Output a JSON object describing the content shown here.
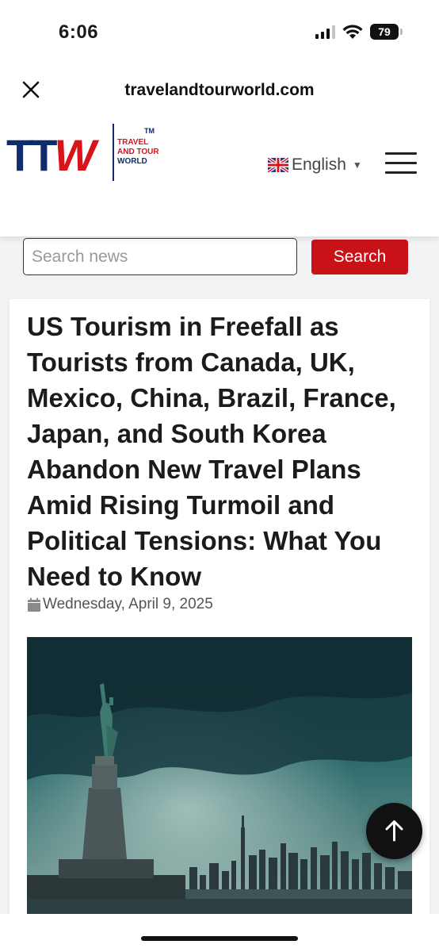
{
  "status_bar": {
    "time": "6:06",
    "battery": "79"
  },
  "browser": {
    "url": "travelandtourworld.com"
  },
  "header": {
    "logo": {
      "mark_tt": "TT",
      "mark_w": "W",
      "line1": "TRAVEL",
      "line2": "AND TOUR",
      "line3": "WORLD",
      "tm": "TM"
    },
    "language": "English",
    "icons": [
      "close-icon",
      "uk-flag-icon",
      "caret-down-icon",
      "hamburger-menu-icon"
    ]
  },
  "search": {
    "placeholder": "Search news",
    "value": "",
    "button_label": "Search"
  },
  "article": {
    "title": "US Tourism in Freefall as Tourists from Canada, UK, Mexico, China, Brazil, France, Japan, and South Korea Abandon New Travel Plans Amid Rising Turmoil and Political Tensions: What You Need to Know",
    "date": "Wednesday, April 9, 2025"
  },
  "colors": {
    "brand_red": "#c81217",
    "brand_navy": "#0f2d6b",
    "background": "#f2f3f4"
  }
}
